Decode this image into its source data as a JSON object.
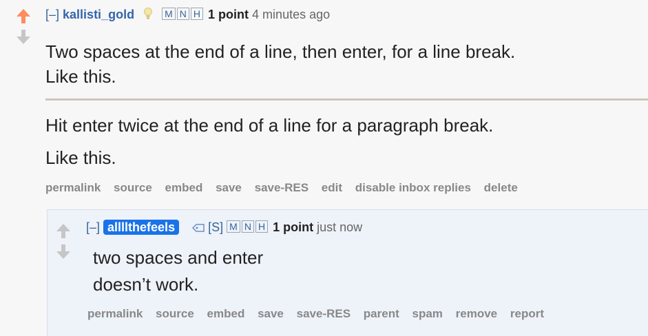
{
  "parent": {
    "expand": "[–]",
    "author": "kallisti_gold",
    "boxes": [
      "M",
      "N",
      "H"
    ],
    "points": "1 point",
    "time": "4 minutes ago",
    "line1": "Two spaces at the end of a line, then enter, for a line break.",
    "line2": "Like this.",
    "line3": "Hit enter twice at the end of a line for a paragraph break.",
    "line4": "Like this.",
    "buttons": [
      "permalink",
      "source",
      "embed",
      "save",
      "save-RES",
      "edit",
      "disable inbox replies",
      "delete"
    ]
  },
  "child": {
    "expand": "[–]",
    "author": "allllthefeels",
    "submitter": "[S]",
    "boxes": [
      "M",
      "N",
      "H"
    ],
    "points": "1 point",
    "time": "just now",
    "line1": "two spaces and enter",
    "line2": "doesn’t work.",
    "buttons": [
      "permalink",
      "source",
      "embed",
      "save",
      "save-RES",
      "parent",
      "spam",
      "remove",
      "report"
    ]
  }
}
